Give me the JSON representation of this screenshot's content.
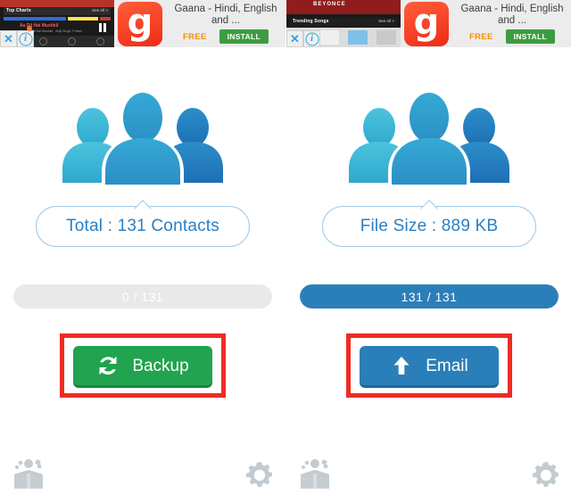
{
  "app": {
    "panels": [
      {
        "id": "left",
        "ad": {
          "title": "Gaana - Hindi, English and ...",
          "free_label": "FREE",
          "install_label": "INSTALL",
          "logo_letter": "g",
          "close_icon": "close-icon",
          "info_icon": "info-icon",
          "thumb": {
            "header": "Top Charts",
            "see_all": "See All >",
            "song_title": "Aa Dil Hai Mushkil",
            "song_sub": "from Ae Dil Hai Mushkil · Arijit Singh, Pritam"
          }
        },
        "bubble_text": "Total : 131 Contacts",
        "progress": {
          "text": "0 / 131",
          "percent": 0,
          "fill_color": "#2b7fb8",
          "track_color": "#e9e9e9"
        },
        "action": {
          "label": "Backup",
          "icon": "sync-refresh-icon",
          "color": "#22a34f",
          "highlight_color": "#ef2c23"
        },
        "bottom": {
          "restore_icon": "open-box-restore-icon",
          "settings_icon": "gear-icon"
        }
      },
      {
        "id": "right",
        "ad": {
          "title": "Gaana - Hindi, English and ...",
          "free_label": "FREE",
          "install_label": "INSTALL",
          "logo_letter": "g",
          "close_icon": "close-icon",
          "info_icon": "info-icon",
          "thumb": {
            "header": "Trending Songs",
            "see_all": "See All >",
            "song_title": "BEYONCE",
            "song_sub": ""
          }
        },
        "bubble_text": "File Size : 889 KB",
        "progress": {
          "text": "131 / 131",
          "percent": 100,
          "fill_color": "#2b7fb8",
          "track_color": "#e9e9e9"
        },
        "action": {
          "label": "Email",
          "icon": "upload-arrow-icon",
          "color": "#2a7fb8",
          "highlight_color": "#ef2c23"
        },
        "bottom": {
          "restore_icon": "open-box-restore-icon",
          "settings_icon": "gear-icon"
        }
      }
    ],
    "people_icon": {
      "name": "contacts-group-icon",
      "left_color_top": "#4cc3dd",
      "left_color_bottom": "#2fa8cf",
      "center_color_top": "#35a9d6",
      "center_color_bottom": "#2b8fc4",
      "right_color_top": "#2b8ec9",
      "right_color_bottom": "#1e6fb4"
    }
  }
}
